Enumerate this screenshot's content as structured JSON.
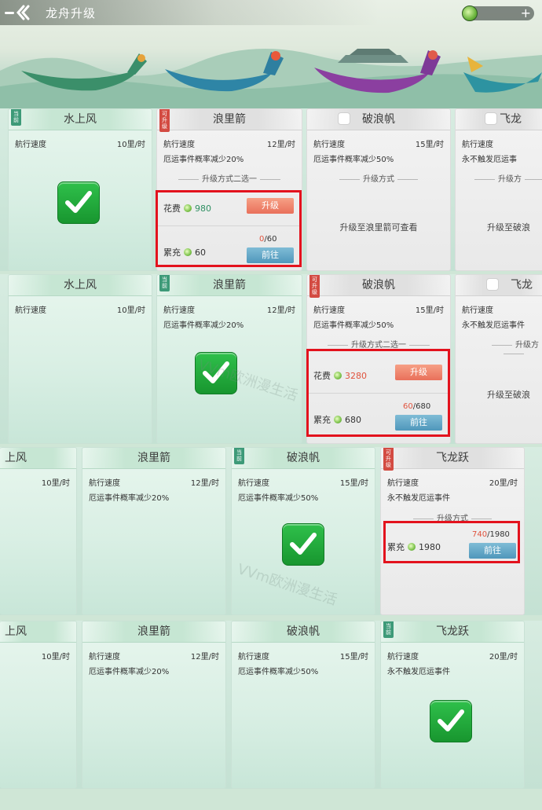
{
  "header": {
    "title": "龙舟升级"
  },
  "colors": {
    "accent_red": "#e3121d",
    "progress_highlight": "#e0533d",
    "check_green": "#1fae3c"
  },
  "panel1": {
    "c1": {
      "name": "水上风",
      "tag": "当前",
      "speed_label": "航行速度",
      "speed": "10里/时"
    },
    "c2": {
      "name": "浪里箭",
      "tag": "可升级",
      "speed_label": "航行速度",
      "speed": "12里/时",
      "effect": "厄运事件概率减少20%",
      "method": "升级方式二选一",
      "cost_label": "花费",
      "cost": "980",
      "upgrade_btn": "升级",
      "fill_label": "累充",
      "fill": "60",
      "prog_cur": "0",
      "prog_total": "/60",
      "go_btn": "前往"
    },
    "c3": {
      "name": "破浪帆",
      "speed_label": "航行速度",
      "speed": "15里/时",
      "effect": "厄运事件概率减少50%",
      "method": "升级方式",
      "hint": "升级至浪里箭可查看"
    },
    "c4": {
      "name": "飞龙",
      "speed_label": "航行速度",
      "effect": "永不触发厄运事",
      "method": "升级方",
      "hint": "升级至破浪"
    }
  },
  "panel2": {
    "c1": {
      "name": "水上风",
      "speed_label": "航行速度",
      "speed": "10里/时"
    },
    "c2": {
      "name": "浪里箭",
      "tag": "当前",
      "speed_label": "航行速度",
      "speed": "12里/时",
      "effect": "厄运事件概率减少20%"
    },
    "c3": {
      "name": "破浪帆",
      "tag": "可升级",
      "speed_label": "航行速度",
      "speed": "15里/时",
      "effect": "厄运事件概率减少50%",
      "method": "升级方式二选一",
      "cost_label": "花费",
      "cost": "3280",
      "upgrade_btn": "升级",
      "fill_label": "累充",
      "fill": "680",
      "prog_cur": "60",
      "prog_total": "/680",
      "go_btn": "前往"
    },
    "c4": {
      "name": "飞龙",
      "speed_label": "航行速度",
      "effect": "永不触发厄运事件",
      "method": "升级方",
      "hint": "升级至破浪"
    }
  },
  "panel3": {
    "c1": {
      "name": "上风",
      "speed": "10里/时"
    },
    "c2": {
      "name": "浪里箭",
      "speed_label": "航行速度",
      "speed": "12里/时",
      "effect": "厄运事件概率减少20%"
    },
    "c3": {
      "name": "破浪帆",
      "tag": "当前",
      "speed_label": "航行速度",
      "speed": "15里/时",
      "effect": "厄运事件概率减少50%"
    },
    "c4": {
      "name": "飞龙跃",
      "tag": "可升级",
      "speed_label": "航行速度",
      "speed": "20里/时",
      "effect": "永不触发厄运事件",
      "method": "升级方式",
      "fill_label": "累充",
      "fill": "1980",
      "prog_cur": "740",
      "prog_total": "/1980",
      "go_btn": "前往"
    }
  },
  "panel4": {
    "c1": {
      "name": "上风",
      "speed": "10里/时"
    },
    "c2": {
      "name": "浪里箭",
      "speed_label": "航行速度",
      "speed": "12里/时",
      "effect": "厄运事件概率减少20%"
    },
    "c3": {
      "name": "破浪帆",
      "speed_label": "航行速度",
      "speed": "15里/时",
      "effect": "厄运事件概率减少50%"
    },
    "c4": {
      "name": "飞龙跃",
      "tag": "当前",
      "speed_label": "航行速度",
      "speed": "20里/时",
      "effect": "永不触发厄运事件"
    }
  },
  "watermark": "VVm欧洲漫生活"
}
